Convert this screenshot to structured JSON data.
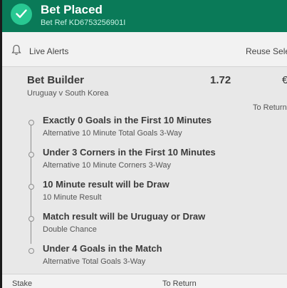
{
  "header": {
    "title": "Bet Placed",
    "bet_ref": "Bet Ref KD6753256901I",
    "accent_color": "#0a7a58",
    "icon": "checkmark-circle-icon"
  },
  "alerts_bar": {
    "live_alerts_label": "Live Alerts",
    "reuse_label": "Reuse Selec",
    "icon": "bell-icon"
  },
  "bet": {
    "title": "Bet Builder",
    "odds": "1.72",
    "stake_prefix": "€",
    "match": "Uruguay v South Korea",
    "to_return_label": "To Return",
    "selections": [
      {
        "name": "Exactly 0 Goals in the First 10 Minutes",
        "market": "Alternative 10 Minute Total Goals 3-Way"
      },
      {
        "name": "Under 3 Corners in the First 10 Minutes",
        "market": "Alternative 10 Minute Corners 3-Way"
      },
      {
        "name": "10 Minute result will be Draw",
        "market": "10 Minute Result"
      },
      {
        "name": "Match result will be Uruguay or Draw",
        "market": "Double Chance"
      },
      {
        "name": "Under 4 Goals in the Match",
        "market": "Alternative Total Goals 3-Way"
      }
    ]
  },
  "footer": {
    "stake_label": "Stake",
    "to_return_label": "To Return"
  }
}
